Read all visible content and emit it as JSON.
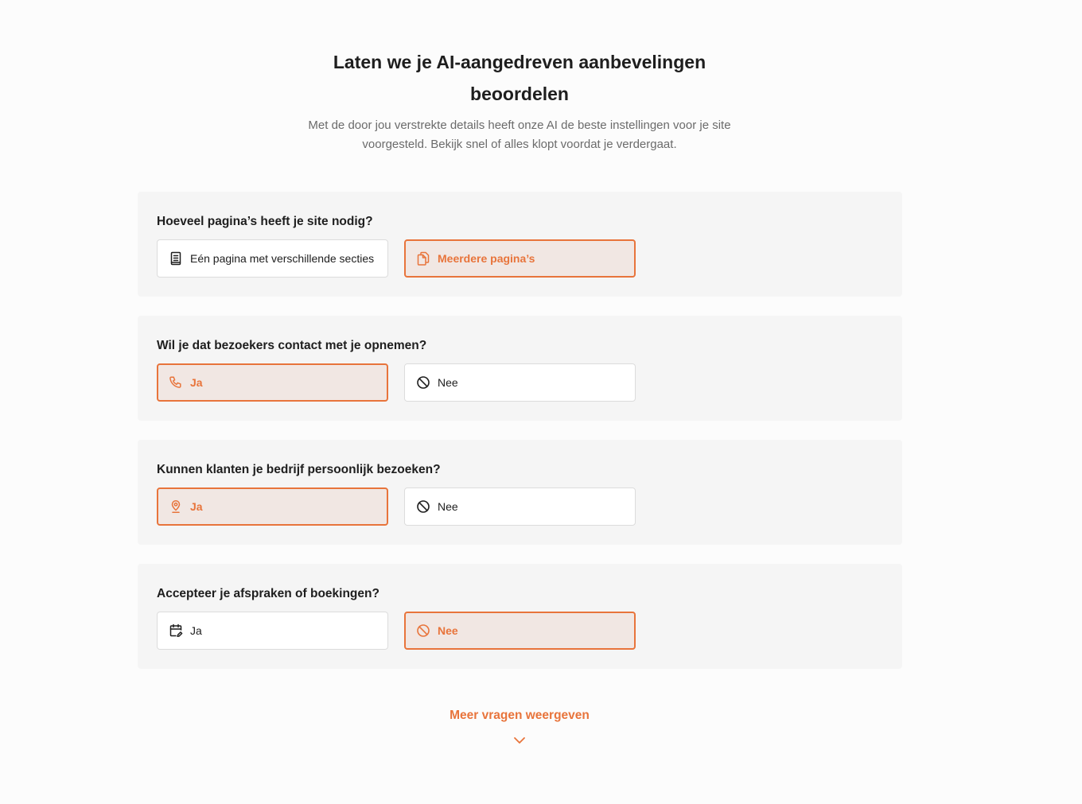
{
  "header": {
    "title": "Laten we je AI-aangedreven aanbevelingen beoordelen",
    "subtitle": "Met de door jou verstrekte details heeft onze AI de beste instellingen voor je site voorgesteld. Bekijk snel of alles klopt voordat je verdergaat."
  },
  "questions": [
    {
      "question": "Hoeveel pagina’s heeft je site nodig?",
      "options": [
        {
          "label": "Eén pagina met verschillende secties",
          "icon": "single-page-icon",
          "selected": false
        },
        {
          "label": "Meerdere pagina’s",
          "icon": "multiple-pages-icon",
          "selected": true
        }
      ]
    },
    {
      "question": "Wil je dat bezoekers contact met je opnemen?",
      "options": [
        {
          "label": "Ja",
          "icon": "phone-icon",
          "selected": true
        },
        {
          "label": "Nee",
          "icon": "ban-icon",
          "selected": false
        }
      ]
    },
    {
      "question": "Kunnen klanten je bedrijf persoonlijk bezoeken?",
      "options": [
        {
          "label": "Ja",
          "icon": "location-pin-icon",
          "selected": true
        },
        {
          "label": "Nee",
          "icon": "ban-icon",
          "selected": false
        }
      ]
    },
    {
      "question": "Accepteer je afspraken of boekingen?",
      "options": [
        {
          "label": "Ja",
          "icon": "calendar-edit-icon",
          "selected": false
        },
        {
          "label": "Nee",
          "icon": "ban-icon",
          "selected": true
        }
      ]
    }
  ],
  "more_button": {
    "label": "Meer vragen weergeven",
    "icon": "chevron-down-icon"
  },
  "colors": {
    "accent": "#e8743b",
    "selected_bg": "#f1e7e3",
    "card_bg": "#f5f5f5",
    "text": "#1e1e1e",
    "muted": "#6b6b6b"
  }
}
